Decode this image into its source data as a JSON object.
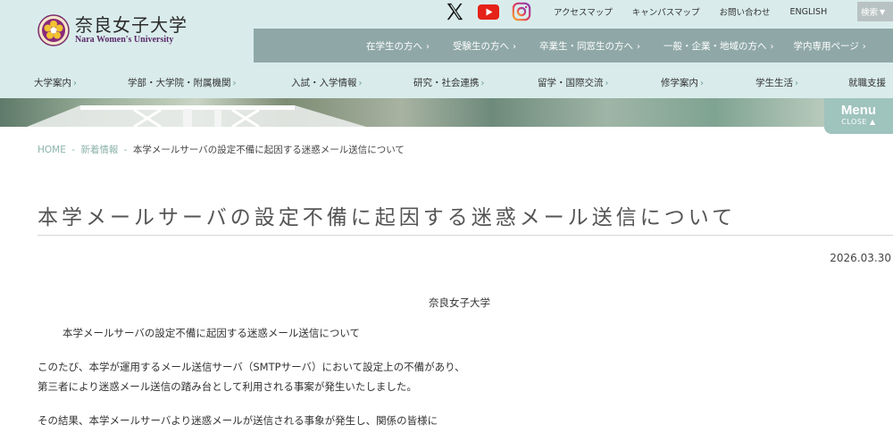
{
  "header": {
    "logo_ja": "奈良女子大学",
    "logo_en": "Nara Women's University",
    "top_links": [
      "アクセスマップ",
      "キャンパスマップ",
      "お問い合わせ",
      "ENGLISH"
    ],
    "search_label": "検索",
    "social": [
      "x-icon",
      "youtube-icon",
      "instagram-icon"
    ],
    "audience_links": [
      "在学生の方へ",
      "受験生の方へ",
      "卒業生・同窓生の方へ",
      "一般・企業・地域の方へ",
      "学内専用ページ"
    ],
    "main_nav": [
      "大学案内",
      "学部・大学院・附属機関",
      "入試・入学情報",
      "研究・社会連携",
      "留学・国際交流",
      "修学案内",
      "学生生活",
      "就職支援"
    ],
    "menu_label": "Menu",
    "menu_close": "CLOSE ▲"
  },
  "breadcrumb": {
    "home": "HOME",
    "news": "新着情報",
    "current": "本学メールサーバの設定不備に起因する迷惑メール送信について",
    "separator": "-"
  },
  "article": {
    "title": "本学メールサーバの設定不備に起因する迷惑メール送信について",
    "date": "2026.03.30",
    "org": "奈良女子大学",
    "subject": "本学メールサーバの設定不備に起因する迷惑メール送信について",
    "para1_line1": "このたび、本学が運用するメール送信サーバ（SMTPサーバ）において設定上の不備があり、",
    "para1_line2": "第三者により迷惑メール送信の踏み台として利用される事案が発生いたしました。",
    "para2_line1": "その結果、本学メールサーバより迷惑メールが送信される事象が発生し、関係の皆様に"
  },
  "colors": {
    "header_bg": "#d9eceb",
    "audience_bar": "#8fa8a7",
    "accent_link": "#8bb3a9",
    "menu_button": "#9fc3bd"
  }
}
